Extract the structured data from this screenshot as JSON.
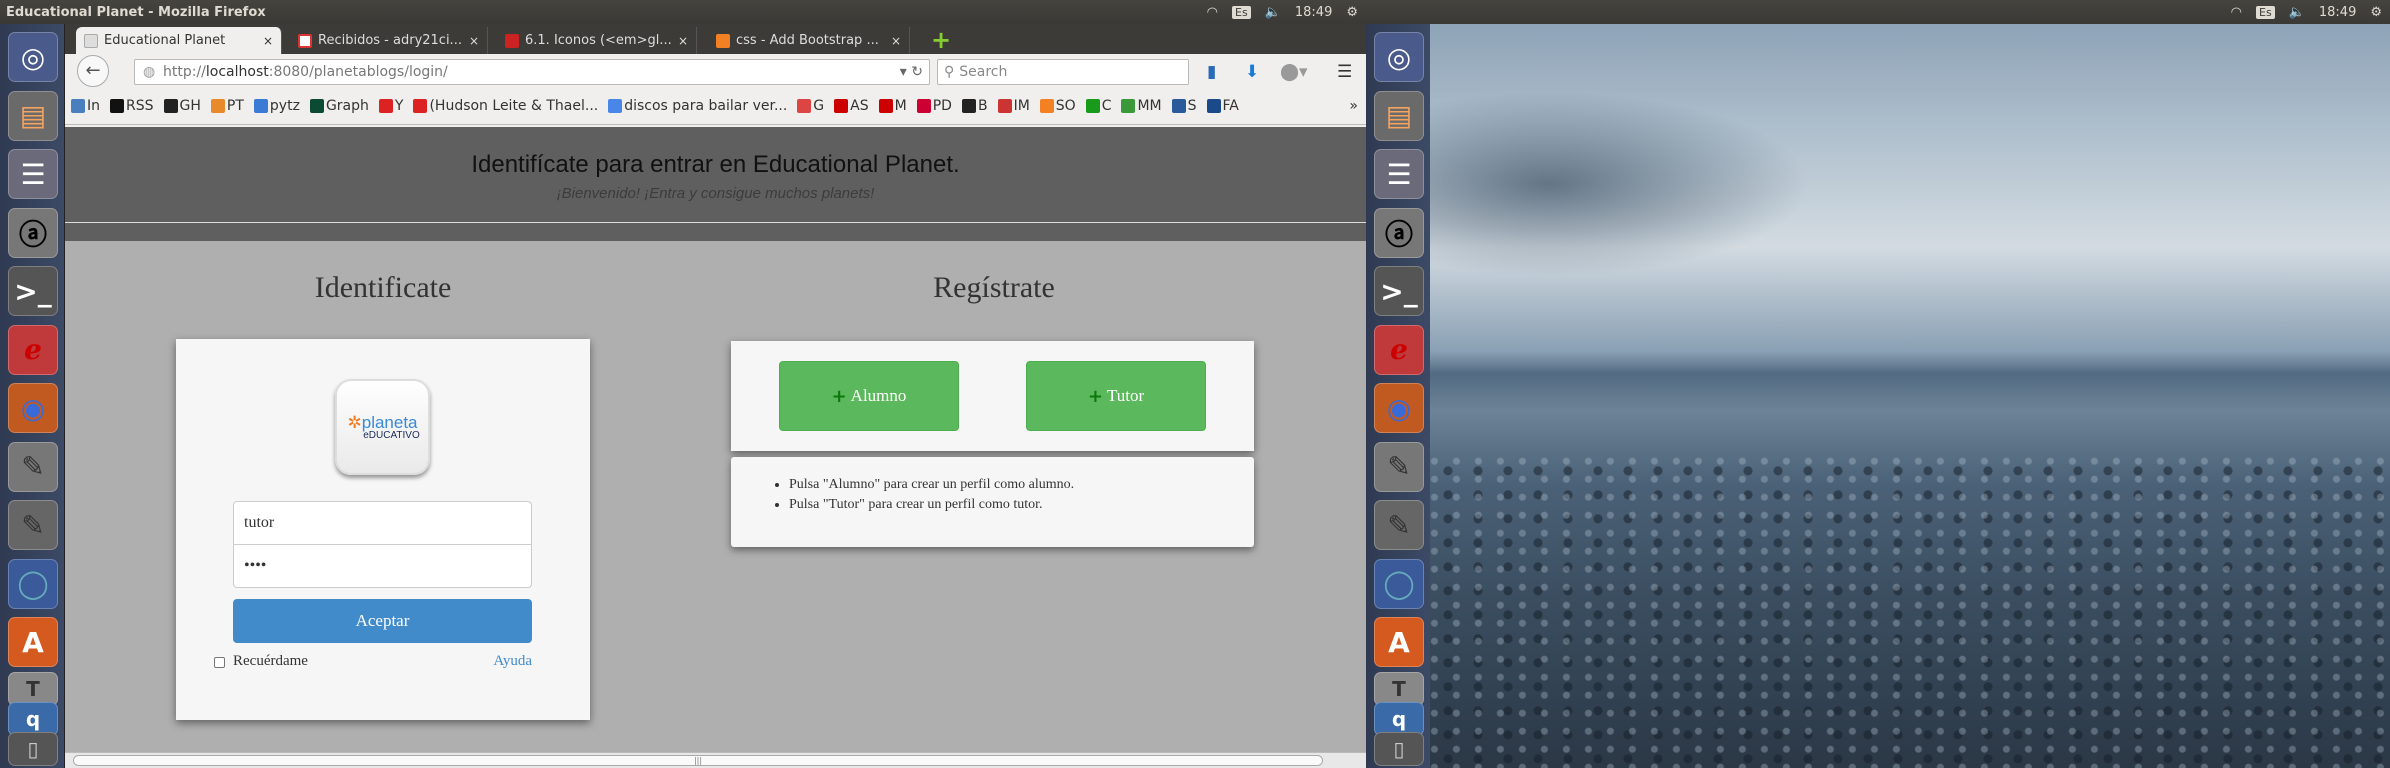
{
  "os_panel": {
    "window_title": "Educational Planet - Mozilla Firefox",
    "keyboard_layout": "Es",
    "time": "18:49"
  },
  "launcher": {
    "items": [
      "ubuntu-dash",
      "files",
      "pidgin",
      "amarok",
      "terminal",
      "evince",
      "firefox",
      "gedit-code",
      "text-editor",
      "chromium",
      "software-center",
      "texmaker",
      "qbittorrent",
      "trash"
    ]
  },
  "browser": {
    "tabs": [
      {
        "label": "Educational Planet",
        "active": true
      },
      {
        "label": "Recibidos - adry21ci..."
      },
      {
        "label": "6.1. Iconos (<em>gl..."
      },
      {
        "label": "css - Add Bootstrap ..."
      }
    ],
    "url": {
      "prefix": "http://",
      "host": "localhost",
      "rest": ":8080/planetablogs/login/"
    },
    "search_placeholder": "Search",
    "bookmarks": [
      {
        "label": "In",
        "color": "#4a7fbf"
      },
      {
        "label": "RSS",
        "color": "#111"
      },
      {
        "label": "GH",
        "color": "#222"
      },
      {
        "label": "PT",
        "color": "#e88a2a"
      },
      {
        "label": "pytz",
        "color": "#3b7bd4"
      },
      {
        "label": "Graph",
        "color": "#0c4b33"
      },
      {
        "label": "Y",
        "color": "#d22"
      },
      {
        "label": "(Hudson Leite & Thael...",
        "color": "#d22"
      },
      {
        "label": "discos para bailar ver...",
        "color": "#4a86e8"
      },
      {
        "label": "G",
        "color": "#d44"
      },
      {
        "label": "AS",
        "color": "#c00"
      },
      {
        "label": "M",
        "color": "#c00"
      },
      {
        "label": "PD",
        "color": "#c03"
      },
      {
        "label": "B",
        "color": "#222"
      },
      {
        "label": "IM",
        "color": "#c33"
      },
      {
        "label": "SO",
        "color": "#f48024"
      },
      {
        "label": "C",
        "color": "#1a9a1a"
      },
      {
        "label": "MM",
        "color": "#3a9a3a"
      },
      {
        "label": "S",
        "color": "#2a5a9a"
      },
      {
        "label": "FA",
        "color": "#1a4a8a"
      }
    ],
    "overflow_label": "»"
  },
  "page": {
    "header_title": "Identifícate para entrar en Educational Planet.",
    "header_subtitle": "¡Bienvenido! ¡Entra y consigue muchos planets!",
    "login": {
      "heading": "Identificate",
      "logo_text": "planeta educativo",
      "username_value": "tutor",
      "password_value": "••••",
      "submit_label": "Aceptar",
      "remember_label": "Recuérdame",
      "remember_checked": false,
      "help_link": "Ayuda"
    },
    "register": {
      "heading": "Regístrate",
      "student_button": "Alumno",
      "tutor_button": "Tutor",
      "info": [
        "Pulsa \"Alumno\" para crear un perfil como alumno.",
        "Pulsa \"Tutor\" para crear un perfil como tutor."
      ]
    }
  },
  "colors": {
    "primary": "#428bca",
    "success": "#5cb85c",
    "header": "#5f5f5f",
    "background": "#afafaf"
  }
}
